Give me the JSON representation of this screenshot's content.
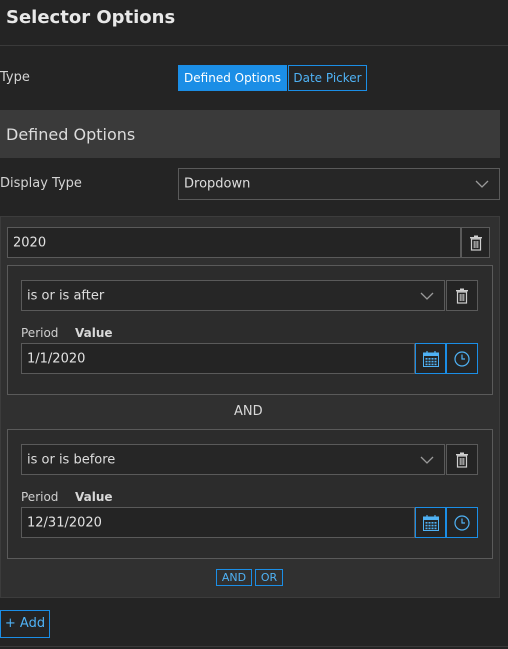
{
  "header": {
    "title": "Selector Options"
  },
  "type_row": {
    "label": "Type",
    "options": [
      "Defined Options",
      "Date Picker"
    ],
    "selected": "Defined Options"
  },
  "section": {
    "title": "Defined Options"
  },
  "display_type": {
    "label": "Display Type",
    "value": "Dropdown"
  },
  "option": {
    "name": "2020",
    "clauses": [
      {
        "operator": "is or is after",
        "period_label": "Period",
        "value_label": "Value",
        "value": "1/1/2020"
      },
      {
        "operator": "is or is before",
        "period_label": "Period",
        "value_label": "Value",
        "value": "12/31/2020"
      }
    ],
    "connector": "AND",
    "connector_buttons": [
      "AND",
      "OR"
    ]
  },
  "footer": {
    "add_label": "+ Add"
  },
  "colors": {
    "accent": "#1b8ee6",
    "background": "#242424",
    "panel": "#303030"
  }
}
